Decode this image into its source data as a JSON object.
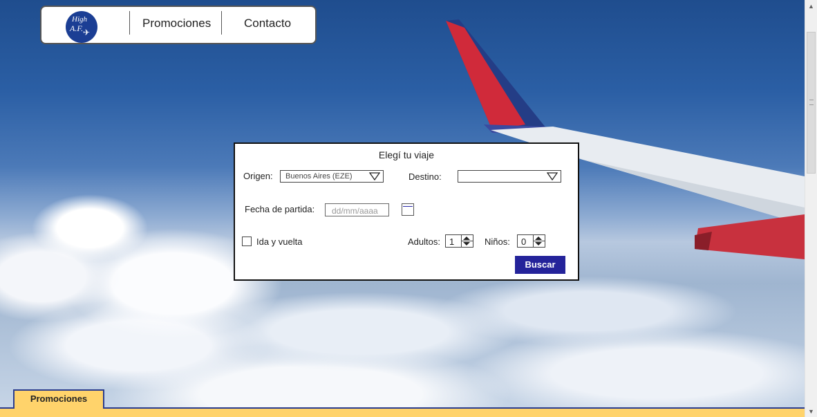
{
  "nav": {
    "logo_line1": "High",
    "logo_line2": "A.F.",
    "links": [
      "Promociones",
      "Contacto"
    ]
  },
  "booking": {
    "title": "Elegí tu viaje",
    "origin_label": "Origen:",
    "origin_value": "Buenos Aires (EZE)",
    "destination_label": "Destino:",
    "destination_value": "",
    "date_label": "Fecha de partida:",
    "date_placeholder": "dd/mm/aaaa",
    "roundtrip_label": "Ida y vuelta",
    "adults_label": "Adultos:",
    "adults_value": "1",
    "children_label": "Niños:",
    "children_value": "0",
    "search_label": "Buscar"
  },
  "bottom": {
    "tab_label": "Promociones"
  },
  "colors": {
    "accent": "#24239a",
    "tab_yellow": "#ffd36b",
    "logo_blue": "#1b3e94"
  }
}
